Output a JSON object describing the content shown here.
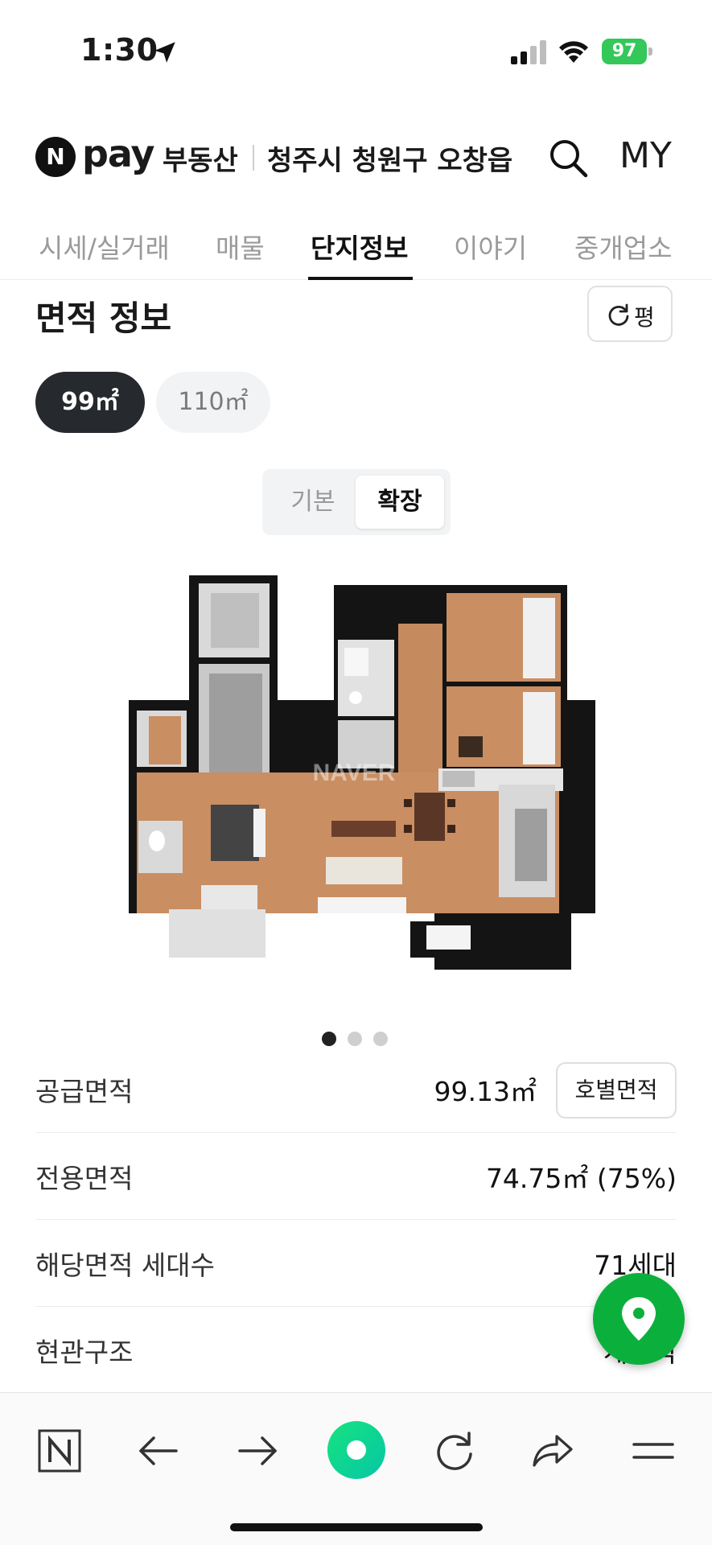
{
  "status_bar": {
    "time": "1:30",
    "battery": "97"
  },
  "header": {
    "brand_pay": "pay",
    "brand_logo_letter": "N",
    "brand_sub": "부동산",
    "region": "청주시 청원구 오창읍",
    "my_label": "MY"
  },
  "tabs": [
    {
      "label": "시세/실거래"
    },
    {
      "label": "매물"
    },
    {
      "label": "단지정보"
    },
    {
      "label": "이야기"
    },
    {
      "label": "중개업소"
    }
  ],
  "section": {
    "title": "면적 정보",
    "unit_toggle": "평"
  },
  "area_chips": [
    {
      "label": "99㎡",
      "selected": true
    },
    {
      "label": "110㎡",
      "selected": false
    }
  ],
  "plan_toggle": {
    "basic": "기본",
    "extended": "확장"
  },
  "floor_plan": {
    "watermark": "NAVER"
  },
  "pagination": {
    "current": 1,
    "total": 3
  },
  "info": {
    "supply_area": {
      "label": "공급면적",
      "value": "99.13㎡",
      "button": "호별면적"
    },
    "exclusive_area": {
      "label": "전용면적",
      "value": "74.75㎡ (75%)"
    },
    "households": {
      "label": "해당면적 세대수",
      "value": "71세대"
    },
    "entrance": {
      "label": "현관구조",
      "value": "계단식"
    }
  },
  "colors": {
    "accent_green": "#0bb03c",
    "battery_green": "#34c759",
    "chip_dark": "#26292d"
  }
}
